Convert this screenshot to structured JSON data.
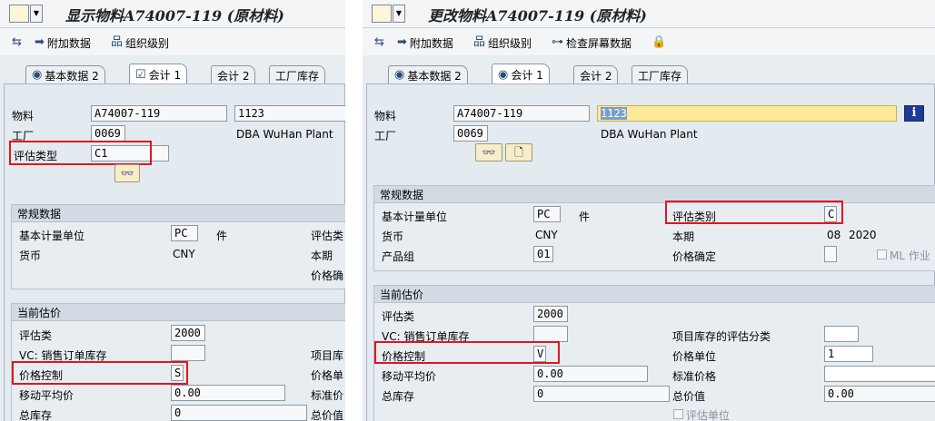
{
  "left": {
    "title": "显示物料A74007-119 (原材料)",
    "toolbar": {
      "additional_data": "附加数据",
      "org_levels": "组织级别"
    },
    "tabs": {
      "basic2": "基本数据 2",
      "accounting1": "会计 1",
      "accounting2": "会计 2",
      "plant_stock": "工厂库存"
    },
    "header": {
      "material_label": "物料",
      "material_value": "A74007-119",
      "material_desc": "1123",
      "plant_label": "工厂",
      "plant_value": "0069",
      "plant_name": "DBA WuHan Plant",
      "val_type_label": "评估类型",
      "val_type_value": "C1"
    },
    "general": {
      "title": "常规数据",
      "base_uom_label": "基本计量单位",
      "base_uom_value": "PC",
      "base_uom_text": "件",
      "currency_label": "货币",
      "currency_value": "CNY",
      "cut_label1": "评估类",
      "cut_label2": "本期",
      "cut_label3": "价格确"
    },
    "current": {
      "title": "当前估价",
      "val_class_label": "评估类",
      "val_class_value": "2000",
      "vc_label": "VC: 销售订单库存",
      "vc_value": "",
      "price_ctrl_label": "价格控制",
      "price_ctrl_value": "S",
      "map_label": "移动平均价",
      "map_value": "0.00",
      "total_stock_label": "总库存",
      "total_stock_value": "0",
      "cut_label1": "项目库",
      "cut_label2": "价格单",
      "cut_label3": "标准价",
      "cut_label4": "总价值"
    }
  },
  "right": {
    "title": "更改物料A74007-119 (原材料)",
    "toolbar": {
      "additional_data": "附加数据",
      "org_levels": "组织级别",
      "check_screen": "检查屏幕数据"
    },
    "tabs": {
      "basic2": "基本数据 2",
      "accounting1": "会计 1",
      "accounting2": "会计 2",
      "plant_stock": "工厂库存"
    },
    "header": {
      "material_label": "物料",
      "material_value": "A74007-119",
      "material_desc": "1123",
      "plant_label": "工厂",
      "plant_value": "0069",
      "plant_name": "DBA WuHan Plant"
    },
    "general": {
      "title": "常规数据",
      "base_uom_label": "基本计量单位",
      "base_uom_value": "PC",
      "base_uom_text": "件",
      "val_cat_label": "评估类别",
      "val_cat_value": "C",
      "currency_label": "货币",
      "currency_value": "CNY",
      "period_label": "本期",
      "period_month": "08",
      "period_year": "2020",
      "prod_group_label": "产品组",
      "prod_group_value": "01",
      "price_det_label": "价格确定",
      "price_det_value": "",
      "ml_label": "ML 作业"
    },
    "current": {
      "title": "当前估价",
      "val_class_label": "评估类",
      "val_class_value": "2000",
      "vc_label": "VC: 销售订单库存",
      "vc_value": "",
      "proj_val_label": "项目库存的评估分类",
      "proj_val_value": "",
      "price_ctrl_label": "价格控制",
      "price_ctrl_value": "V",
      "price_unit_label": "价格单位",
      "price_unit_value": "1",
      "map_label": "移动平均价",
      "map_value": "0.00",
      "std_price_label": "标准价格",
      "std_price_value": "",
      "total_stock_label": "总库存",
      "total_stock_value": "0",
      "total_value_label": "总价值",
      "total_value_value": "0.00",
      "val_unit_label": "评估单位"
    }
  }
}
